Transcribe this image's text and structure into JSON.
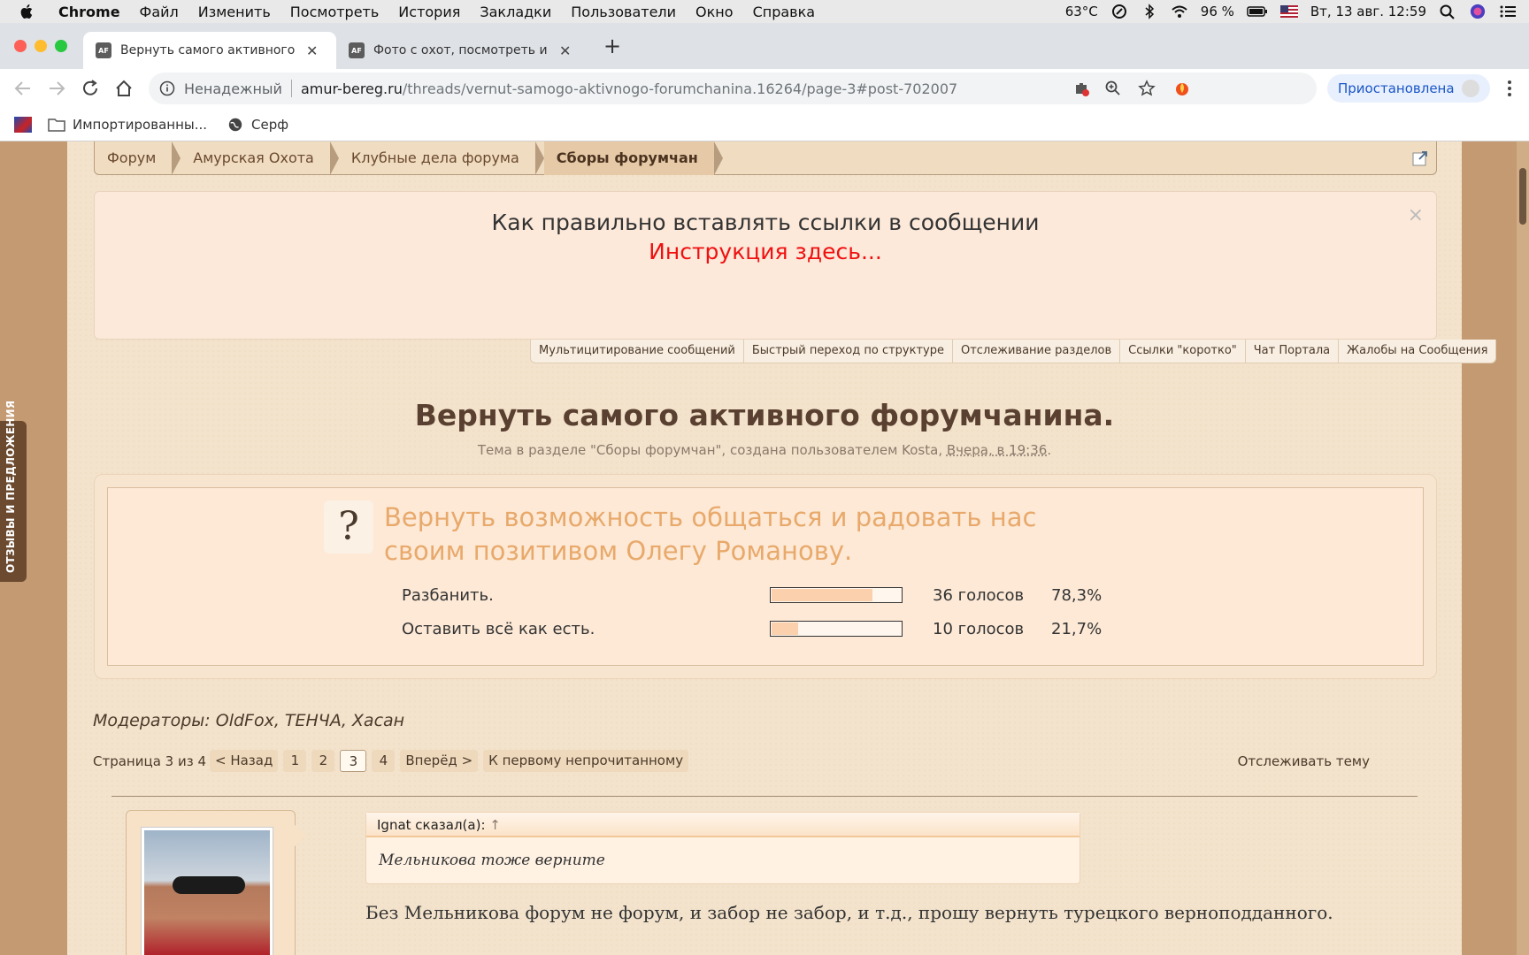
{
  "menubar": {
    "app": "Chrome",
    "items": [
      "Файл",
      "Изменить",
      "Посмотреть",
      "История",
      "Закладки",
      "Пользователи",
      "Окно",
      "Справка"
    ],
    "temp": "63°C",
    "battery": "96 %",
    "datetime": "Вт, 13 авг. 12:59"
  },
  "tabs": [
    {
      "title": "Вернуть самого активного фо",
      "favicon": "AF"
    },
    {
      "title": "Фото с охот, посмотреть и вс",
      "favicon": "AF"
    }
  ],
  "toolbar": {
    "insecure_label": "Ненадежный",
    "url_host": "amur-bereg.ru",
    "url_path": "/threads/vernut-samogo-aktivnogo-forumchanina.16264/page-3#post-702007",
    "profile_label": "Приостановлена"
  },
  "bookmarks": [
    {
      "label": "Импортированны...",
      "icon": "folder-icon"
    },
    {
      "label": "Серф",
      "icon": "globe-icon"
    }
  ],
  "breadcrumb": [
    "Форум",
    "Амурская Охота",
    "Клубные дела форума",
    "Сборы форумчан"
  ],
  "notice": {
    "line1": "Как правильно вставлять ссылки в сообщении",
    "line2": "Инструкция здесь...",
    "close": "×"
  },
  "quicklinks": [
    "Мультицитирование сообщений",
    "Быстрый переход по структуре",
    "Отслеживание разделов",
    "Ссылки \"коротко\"",
    "Чат Портала",
    "Жалобы на Сообщения"
  ],
  "thread": {
    "title": "Вернуть самого активного форумчанина.",
    "meta_prefix": "Тема в разделе \"Сборы форумчан\", создана пользователем Kosta, ",
    "meta_time": "Вчера, в 19:36",
    "meta_suffix": "."
  },
  "poll": {
    "icon": "?",
    "question": "Вернуть возможность общаться и радовать нас своим позитивом Олегу Романову.",
    "options": [
      {
        "label": "Разбанить.",
        "votes": "36 голосов",
        "percent": "78,3%",
        "fraction": 0.783
      },
      {
        "label": "Оставить всё как есть.",
        "votes": "10 голосов",
        "percent": "21,7%",
        "fraction": 0.217
      }
    ]
  },
  "moderators": "Модераторы: OldFox, ТЕНЧА, Хасан",
  "pagination": {
    "label": "Страница 3 из 4",
    "prev": "< Назад",
    "pages": [
      "1",
      "2",
      "3",
      "4"
    ],
    "current": "3",
    "next": "Вперёд >",
    "first_unread": "К первому непрочитанному",
    "watch": "Отслеживать тему"
  },
  "post": {
    "quote_author": "Ignat сказал(а):",
    "quote_arrow": "↑",
    "quote_text": "Мельникова тоже верните",
    "text": "Без Мельникова форум не форум, и забор не забор, и т.д., прошу вернуть турецкого верноподданного."
  },
  "side_tab": "ОТЗЫВЫ И ПРЕДЛОЖЕНИЯ"
}
